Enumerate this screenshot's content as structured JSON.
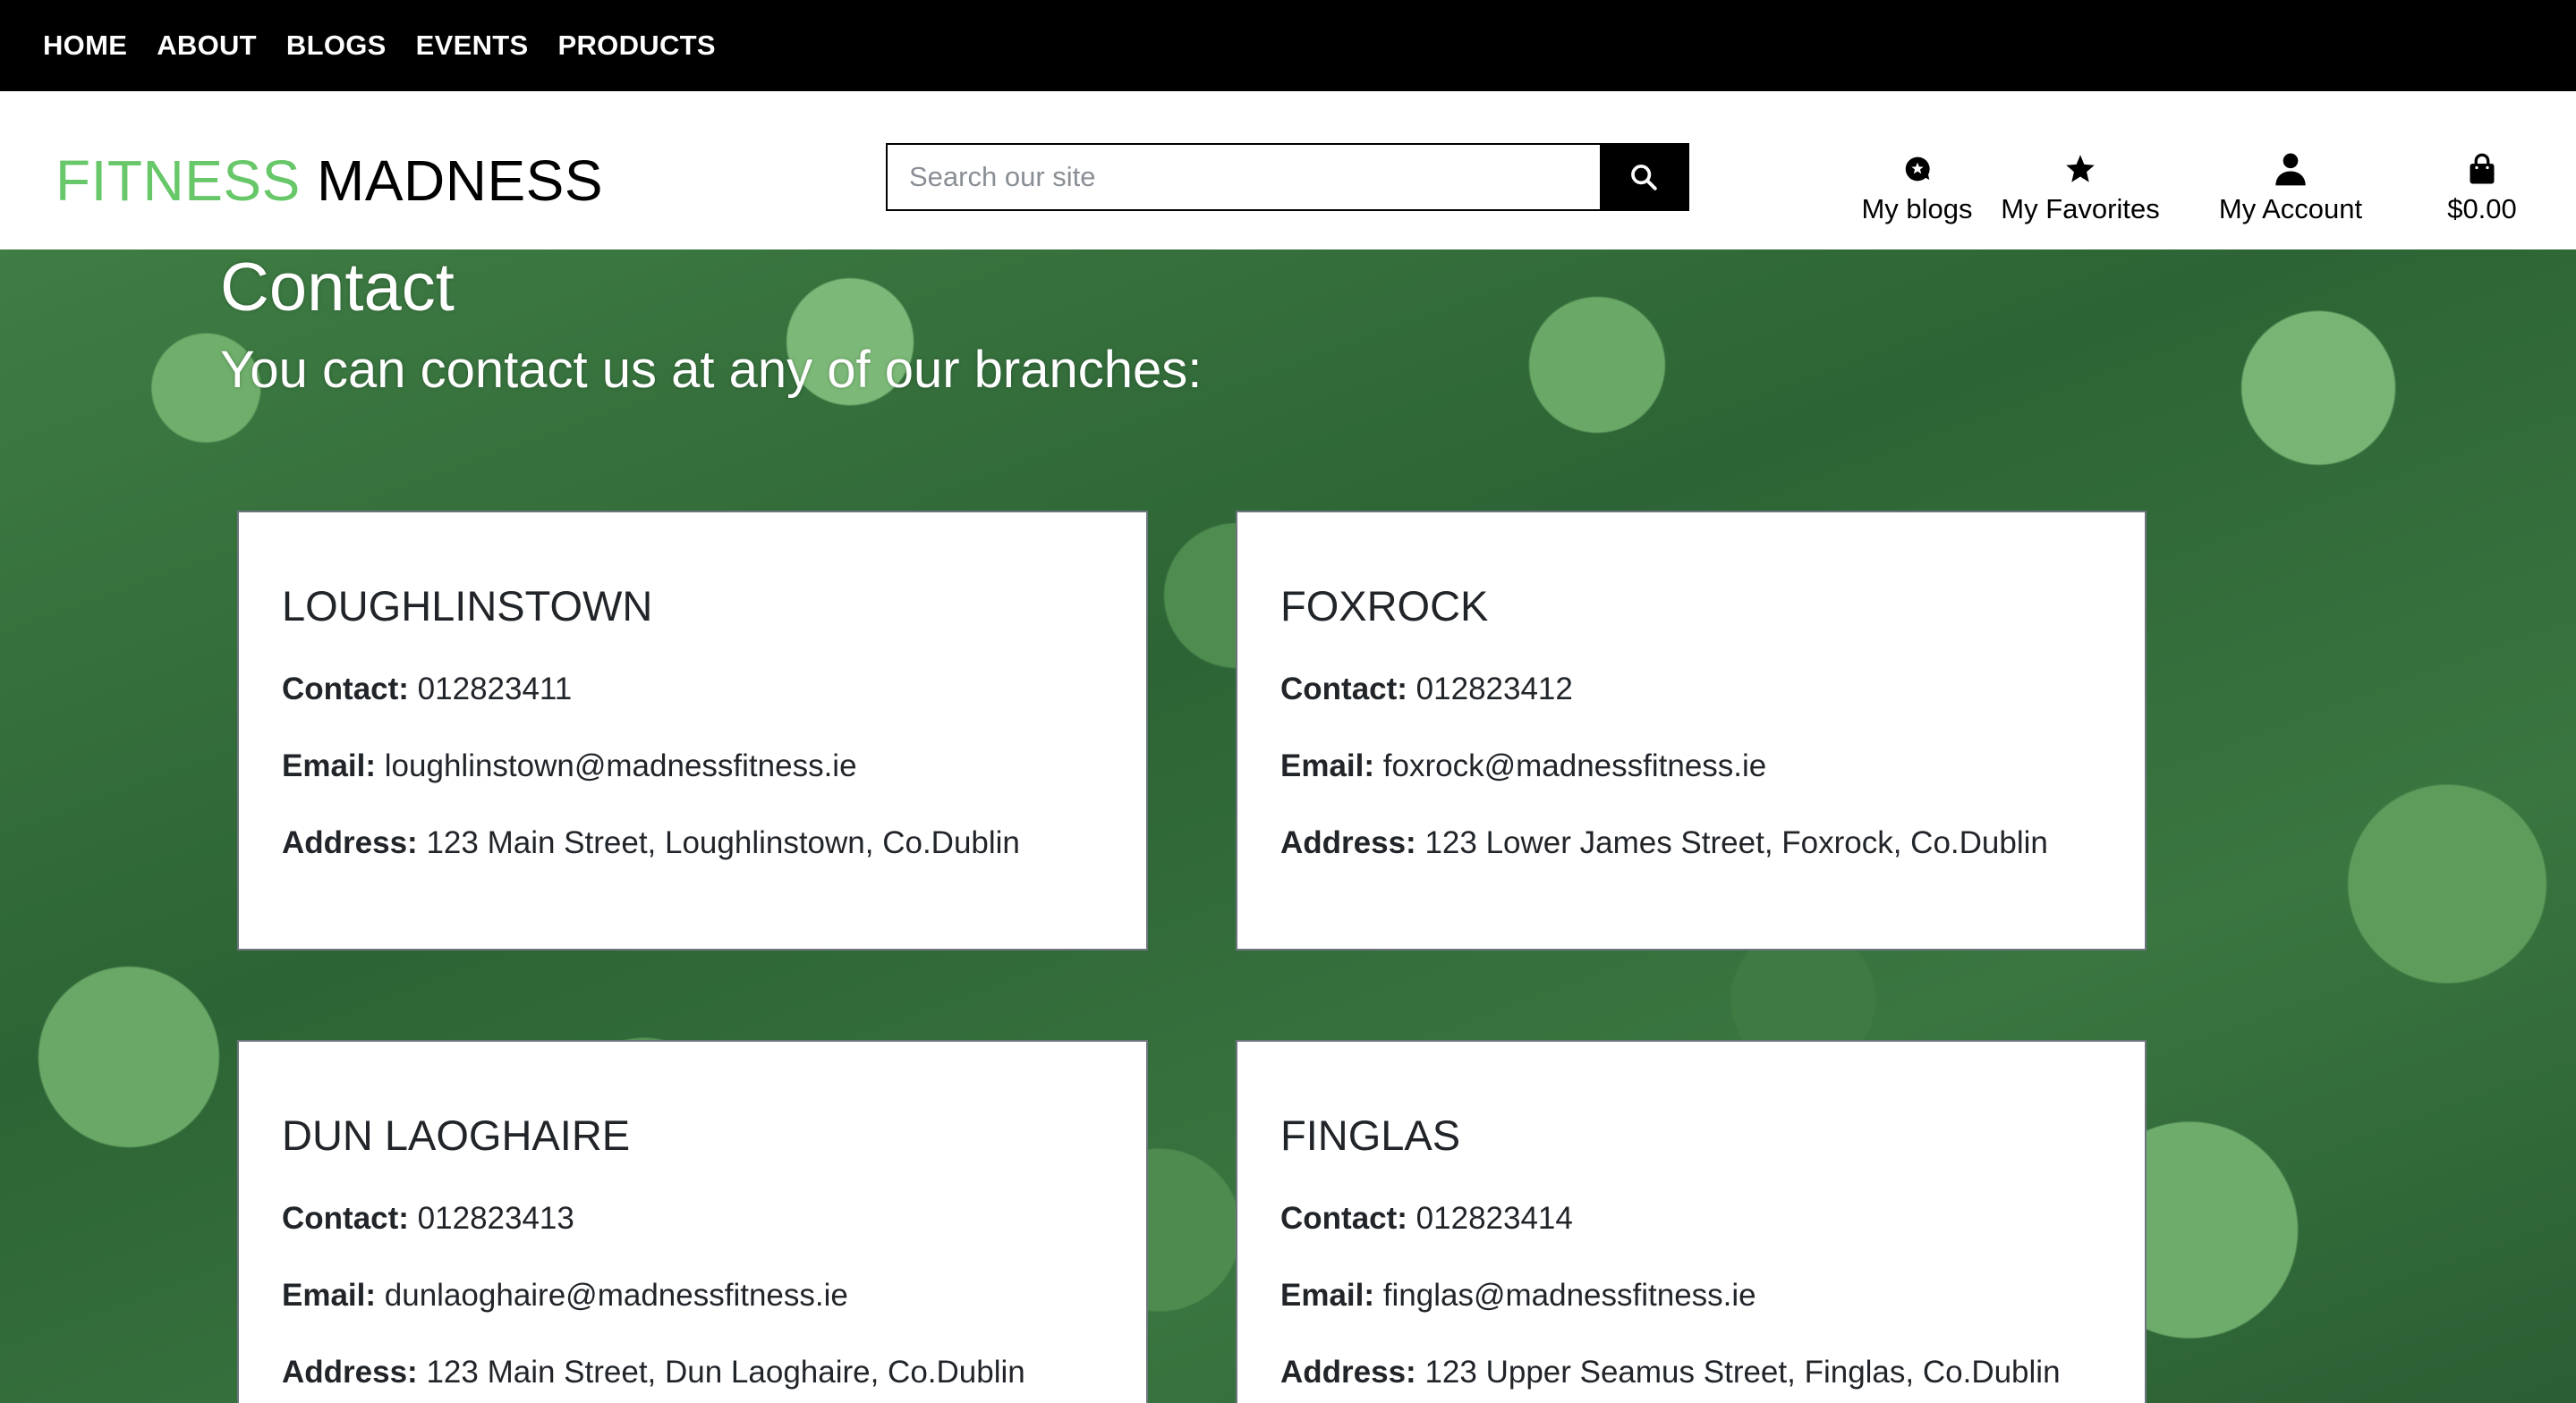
{
  "nav": {
    "items": [
      {
        "label": "HOME",
        "name": "nav-home"
      },
      {
        "label": "ABOUT",
        "name": "nav-about"
      },
      {
        "label": "BLOGS",
        "name": "nav-blogs"
      },
      {
        "label": "EVENTS",
        "name": "nav-events"
      },
      {
        "label": "PRODUCTS",
        "name": "nav-products"
      }
    ]
  },
  "header": {
    "logo_part1": "FITNESS",
    "logo_part2": "MADNESS",
    "logo_part1_color": "#67c769",
    "search_placeholder": "Search our site",
    "search_icon": "search-icon",
    "links": {
      "blogs": {
        "label": "My blogs",
        "icon": "blog-bubble-icon"
      },
      "favorites": {
        "label": "My Favorites",
        "icon": "star-icon"
      },
      "account": {
        "label": "My Account",
        "icon": "user-icon"
      },
      "cart": {
        "label": "$0.00",
        "icon": "shopping-bag-icon"
      }
    }
  },
  "hero": {
    "title": "Contact",
    "subtitle": "You can contact us at any of our branches:"
  },
  "labels": {
    "contact": "Contact:",
    "email": "Email:",
    "address": "Address:"
  },
  "branches": [
    {
      "name": "LOUGHLINSTOWN",
      "contact": "012823411",
      "email": "loughlinstown@madnessfitness.ie",
      "address": "123 Main Street, Loughlinstown, Co.Dublin"
    },
    {
      "name": "FOXROCK",
      "contact": "012823412",
      "email": "foxrock@madnessfitness.ie",
      "address": "123 Lower James Street, Foxrock, Co.Dublin"
    },
    {
      "name": "DUN LAOGHAIRE",
      "contact": "012823413",
      "email": "dunlaoghaire@madnessfitness.ie",
      "address": "123 Main Street, Dun Laoghaire, Co.Dublin"
    },
    {
      "name": "FINGLAS",
      "contact": "012823414",
      "email": "finglas@madnessfitness.ie",
      "address": "123 Upper Seamus Street, Finglas, Co.Dublin"
    }
  ]
}
